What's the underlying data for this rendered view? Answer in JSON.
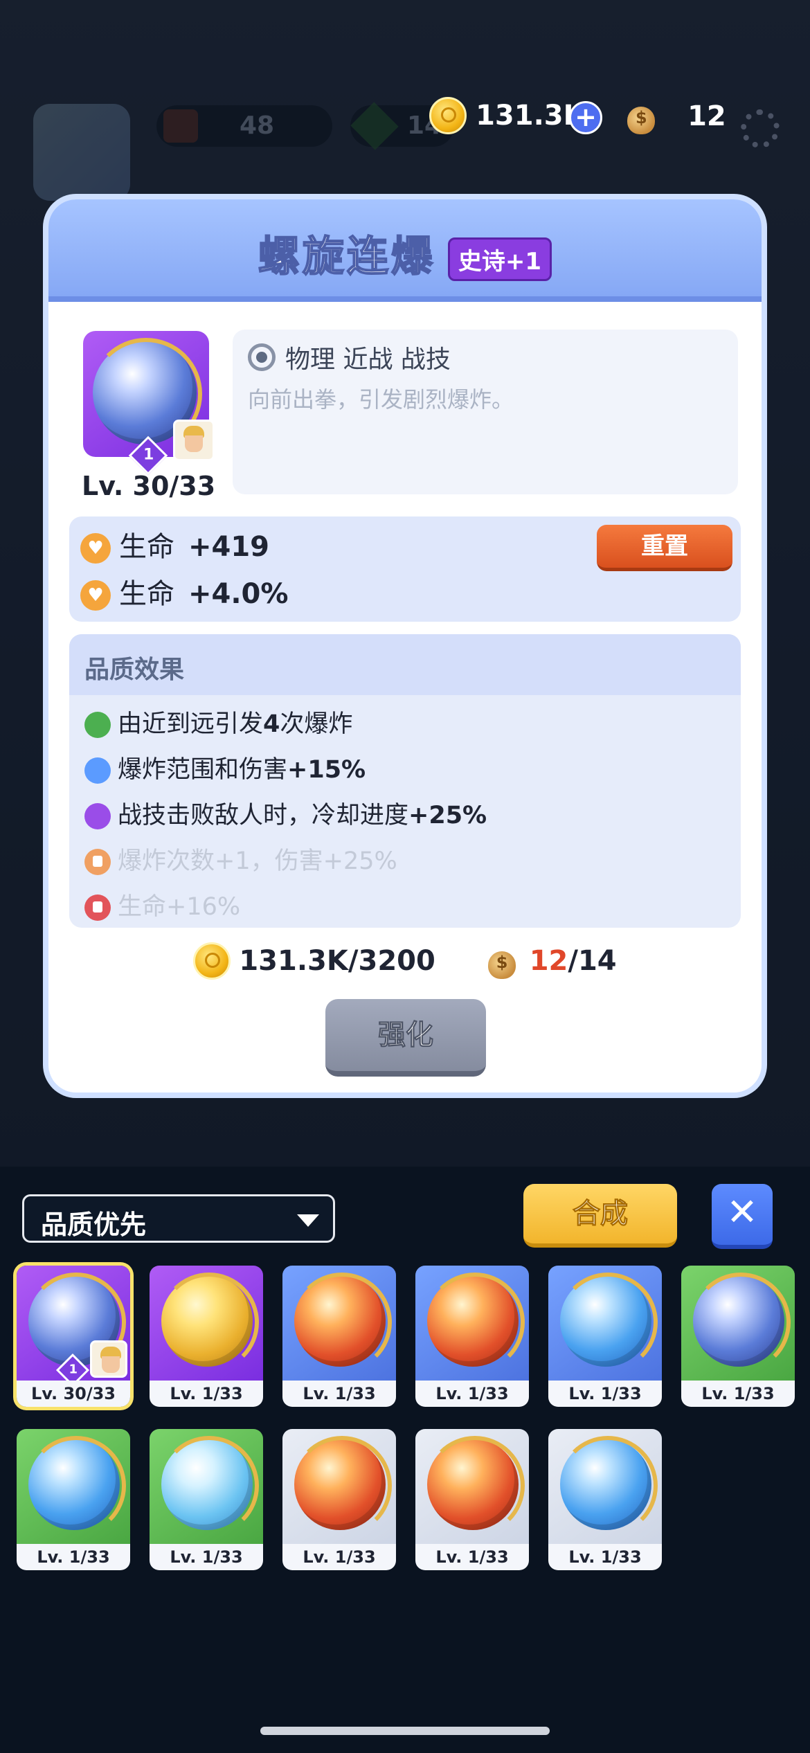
{
  "hud": {
    "items": [
      {
        "icon": "cake-icon",
        "value": "48"
      },
      {
        "icon": "green-gem-icon",
        "value": "14"
      },
      {
        "icon": "coin-icon",
        "value": "131.3K"
      },
      {
        "icon": "bag-icon",
        "value": "12"
      }
    ],
    "gold": "131.3K",
    "bags": "12"
  },
  "skill": {
    "name": "螺旋连爆",
    "rarity": "史诗+1",
    "rank": "1",
    "level": "Lv. 30/33",
    "type": "物理 近战 战技",
    "description": "向前出拳，引发剧烈爆炸。"
  },
  "stats": {
    "rows": [
      {
        "label": "生命",
        "value": "+419"
      },
      {
        "label": "生命",
        "value": "+4.0%"
      }
    ],
    "reset_label": "重置"
  },
  "quality": {
    "title": "品质效果",
    "effects": [
      {
        "pre": "由近到远引发",
        "bold": "4",
        "post": "次爆炸",
        "color": "#4caf50",
        "locked": false
      },
      {
        "pre": "爆炸范围和伤害",
        "bold": "+15%",
        "post": "",
        "color": "#5b9bff",
        "locked": false
      },
      {
        "pre": "战技击败敌人时，冷却进度",
        "bold": "+25%",
        "post": "",
        "color": "#9a4de8",
        "locked": false
      },
      {
        "pre": "爆炸次数",
        "bold": "+1",
        "post": "，伤害+25%",
        "color": "#f0a062",
        "locked": true
      },
      {
        "pre": "生命",
        "bold": "+16%",
        "post": "",
        "color": "#e2545a",
        "locked": true
      }
    ]
  },
  "cost": {
    "gold_have": "131.3K",
    "gold_need": "/3200",
    "bag_have": "12",
    "bag_need": "/14"
  },
  "upgrade_label": "强化",
  "inventory": {
    "sort_label": "品质优先",
    "merge_label": "合成",
    "close_label": "✕",
    "cards": [
      {
        "bg": "purple",
        "orb": "dark",
        "level": "Lv. 30/33",
        "selected": true
      },
      {
        "bg": "purple",
        "orb": "gold",
        "level": "Lv. 1/33",
        "selected": false
      },
      {
        "bg": "blue",
        "orb": "fire",
        "level": "Lv. 1/33",
        "selected": false
      },
      {
        "bg": "blue",
        "orb": "fire",
        "level": "Lv. 1/33",
        "selected": false
      },
      {
        "bg": "blue",
        "orb": "blue",
        "level": "Lv. 1/33",
        "selected": false
      },
      {
        "bg": "green",
        "orb": "dark",
        "level": "Lv. 1/33",
        "selected": false
      },
      {
        "bg": "green",
        "orb": "blue",
        "level": "Lv. 1/33",
        "selected": false
      },
      {
        "bg": "green",
        "orb": "ice",
        "level": "Lv. 1/33",
        "selected": false
      },
      {
        "bg": "grey",
        "orb": "fire",
        "level": "Lv. 1/33",
        "selected": false
      },
      {
        "bg": "grey",
        "orb": "fire",
        "level": "Lv. 1/33",
        "selected": false
      },
      {
        "bg": "grey",
        "orb": "blue",
        "level": "Lv. 1/33",
        "selected": false
      }
    ]
  }
}
